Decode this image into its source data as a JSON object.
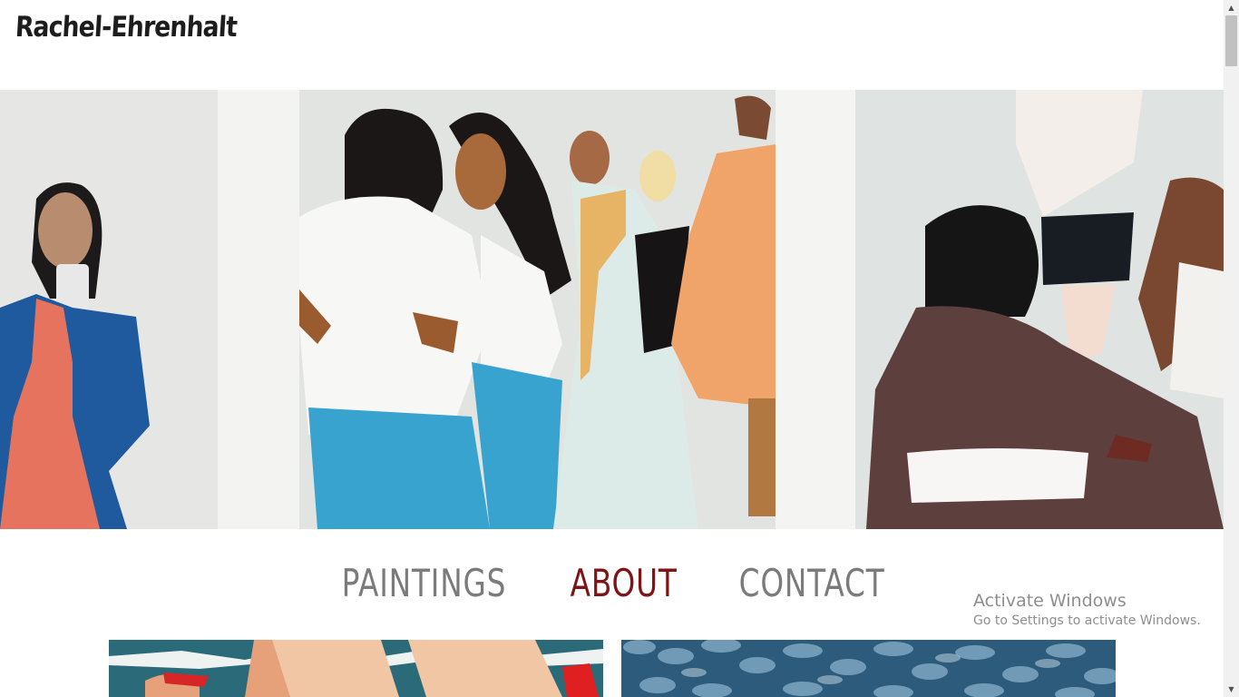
{
  "header": {
    "site_title": "Rachel-Ehrenhalt"
  },
  "nav": {
    "items": [
      {
        "label": "PAINTINGS",
        "active": false
      },
      {
        "label": "ABOUT",
        "active": true
      },
      {
        "label": "CONTACT",
        "active": false
      }
    ],
    "active_color": "#7e1416",
    "inactive_color": "#7b7b7b"
  },
  "hero": {
    "image": "painting-women-mirror-selfie-dressing-room"
  },
  "gallery": [
    {
      "image": "painting-swimmers-in-pool"
    },
    {
      "image": "painting-blue-scales-pattern"
    }
  ],
  "os_watermark": {
    "title": "Activate Windows",
    "subtitle": "Go to Settings to activate Windows."
  },
  "scrollbar": {
    "up_icon": "scroll-up-arrow-icon",
    "down_icon": "scroll-down-arrow-icon"
  }
}
